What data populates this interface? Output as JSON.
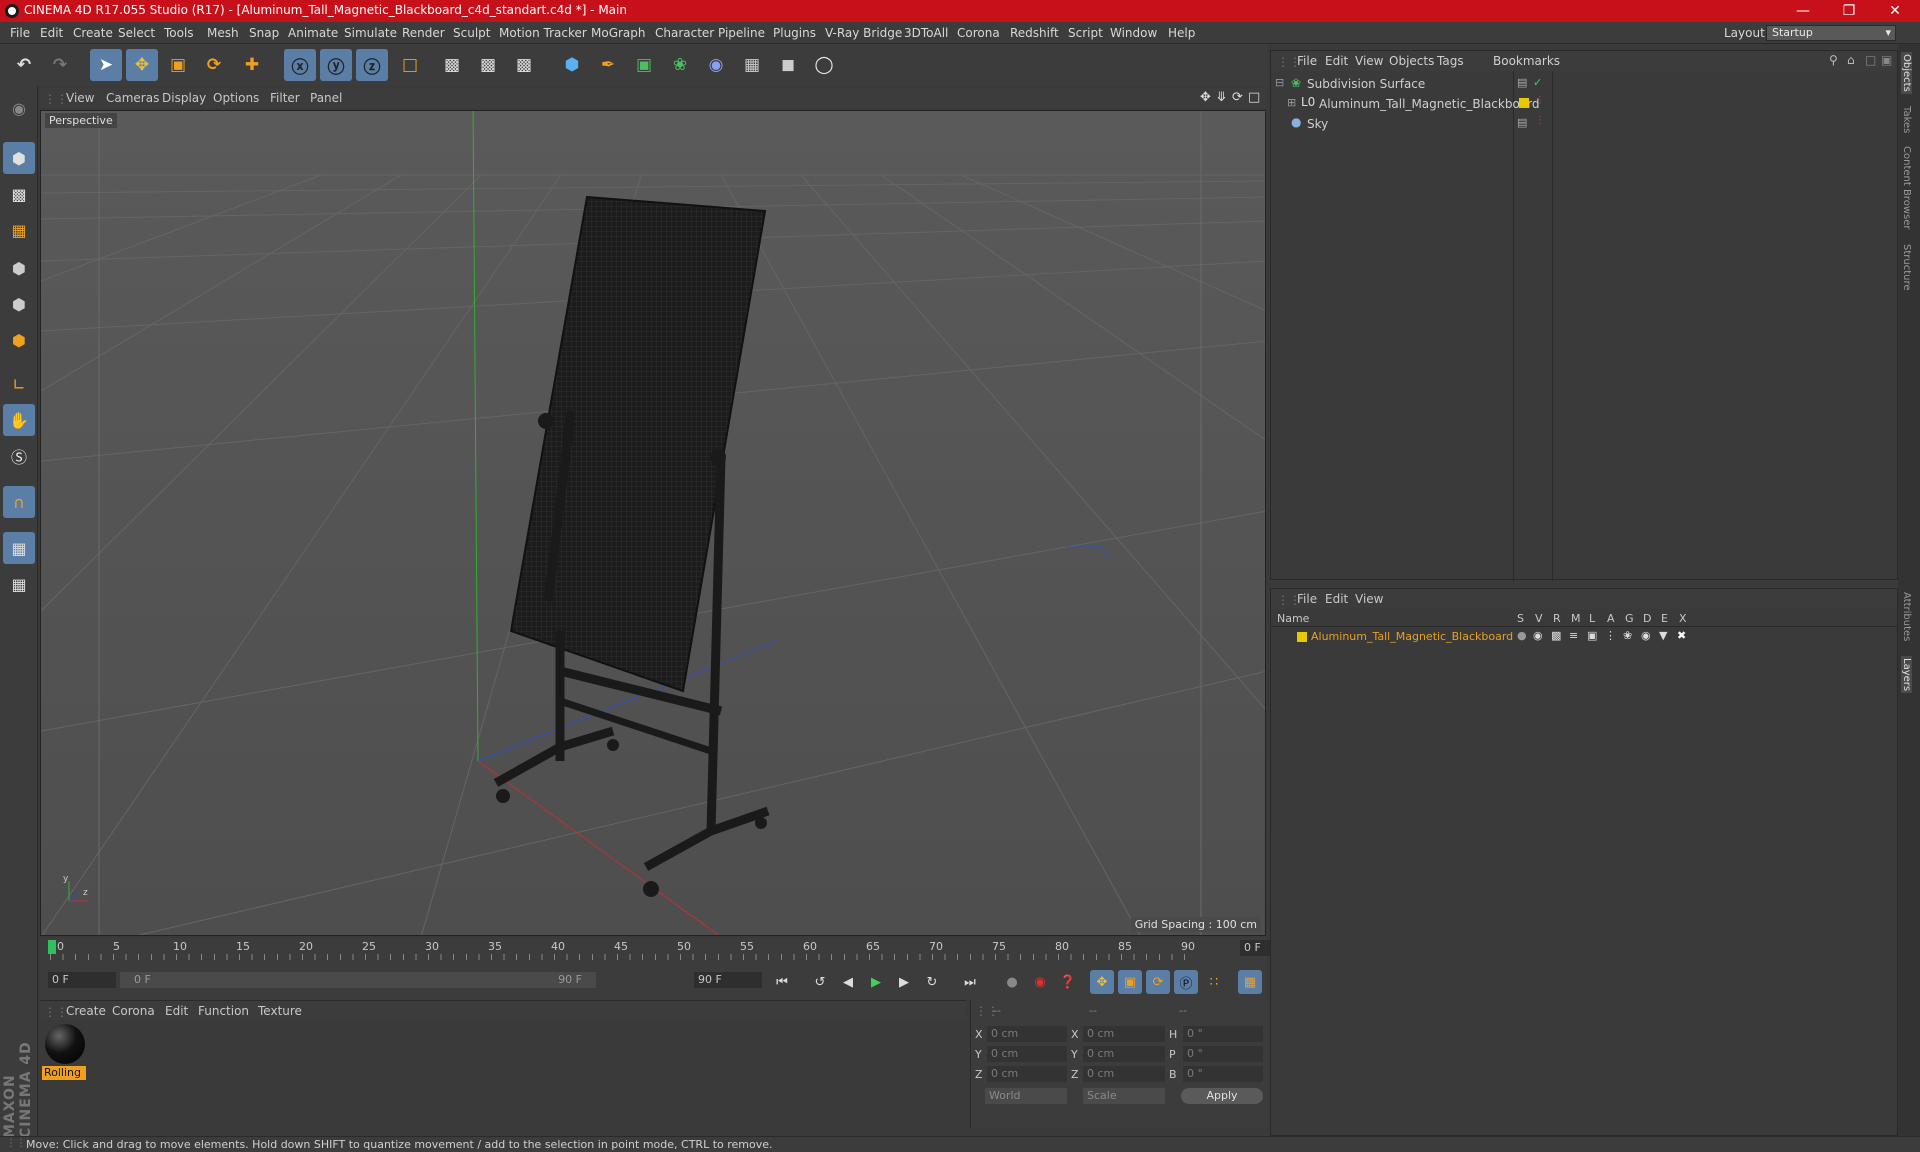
{
  "window": {
    "title": "CINEMA 4D R17.055 Studio (R17) - [Aluminum_Tall_Magnetic_Blackboard_c4d_standart.c4d *] - Main"
  },
  "menu": [
    "File",
    "Edit",
    "Create",
    "Select",
    "Tools",
    "Mesh",
    "Snap",
    "Animate",
    "Simulate",
    "Render",
    "Sculpt",
    "Motion Tracker",
    "MoGraph",
    "Character",
    "Pipeline",
    "Plugins",
    "V-Ray Bridge",
    "3DToAll",
    "Corona",
    "Redshift",
    "Script",
    "Window",
    "Help"
  ],
  "layout": {
    "label": "Layout:",
    "value": "Startup"
  },
  "viewport": {
    "menu": [
      "View",
      "Cameras",
      "Display",
      "Options",
      "Filter",
      "Panel"
    ],
    "label": "Perspective",
    "grid_spacing": "Grid Spacing : 100 cm"
  },
  "timeline": {
    "ticks": [
      "0",
      "5",
      "10",
      "15",
      "20",
      "25",
      "30",
      "35",
      "40",
      "45",
      "50",
      "55",
      "60",
      "65",
      "70",
      "75",
      "80",
      "85",
      "90"
    ],
    "current_frame": "0 F",
    "start_field": "0 F",
    "range_start": "0 F",
    "range_end": "90 F",
    "end_field": "90 F"
  },
  "material": {
    "menu": [
      "Create",
      "Corona",
      "Edit",
      "Function",
      "Texture"
    ],
    "items": [
      {
        "label": "Rolling"
      }
    ]
  },
  "coords": {
    "header": [
      "--",
      "--",
      "--"
    ],
    "rows": [
      {
        "a": "X",
        "av": "0 cm",
        "b": "X",
        "bv": "0 cm",
        "c": "H",
        "cv": "0 °"
      },
      {
        "a": "Y",
        "av": "0 cm",
        "b": "Y",
        "bv": "0 cm",
        "c": "P",
        "cv": "0 °"
      },
      {
        "a": "Z",
        "av": "0 cm",
        "b": "Z",
        "bv": "0 cm",
        "c": "B",
        "cv": "0 °"
      }
    ],
    "world": "World",
    "scale": "Scale",
    "apply": "Apply"
  },
  "objects": {
    "menu": [
      "File",
      "Edit",
      "View",
      "Objects",
      "Tags",
      "Bookmarks"
    ],
    "items": [
      {
        "name": "Subdivision Surface"
      },
      {
        "name": "Aluminum_Tall_Magnetic_Blackboard"
      },
      {
        "name": "Sky"
      }
    ]
  },
  "layers": {
    "menu": [
      "File",
      "Edit",
      "View"
    ],
    "columns": [
      "Name",
      "S",
      "V",
      "R",
      "M",
      "L",
      "A",
      "G",
      "D",
      "E",
      "X"
    ],
    "items": [
      {
        "name": "Aluminum_Tall_Magnetic_Blackboard"
      }
    ]
  },
  "right_tabs": [
    "Objects",
    "Takes",
    "Content Browser",
    "Structure",
    "Attributes",
    "Layers"
  ],
  "brand": "MAXON CINEMA 4D",
  "status": "Move: Click and drag to move elements. Hold down SHIFT to quantize movement / add to the selection in point mode, CTRL to remove.",
  "colors": {
    "title_bar": "#c8101a",
    "accent": "#5b7ea7",
    "layer_yellow": "#e8c800",
    "layer_text": "#e8a020"
  }
}
